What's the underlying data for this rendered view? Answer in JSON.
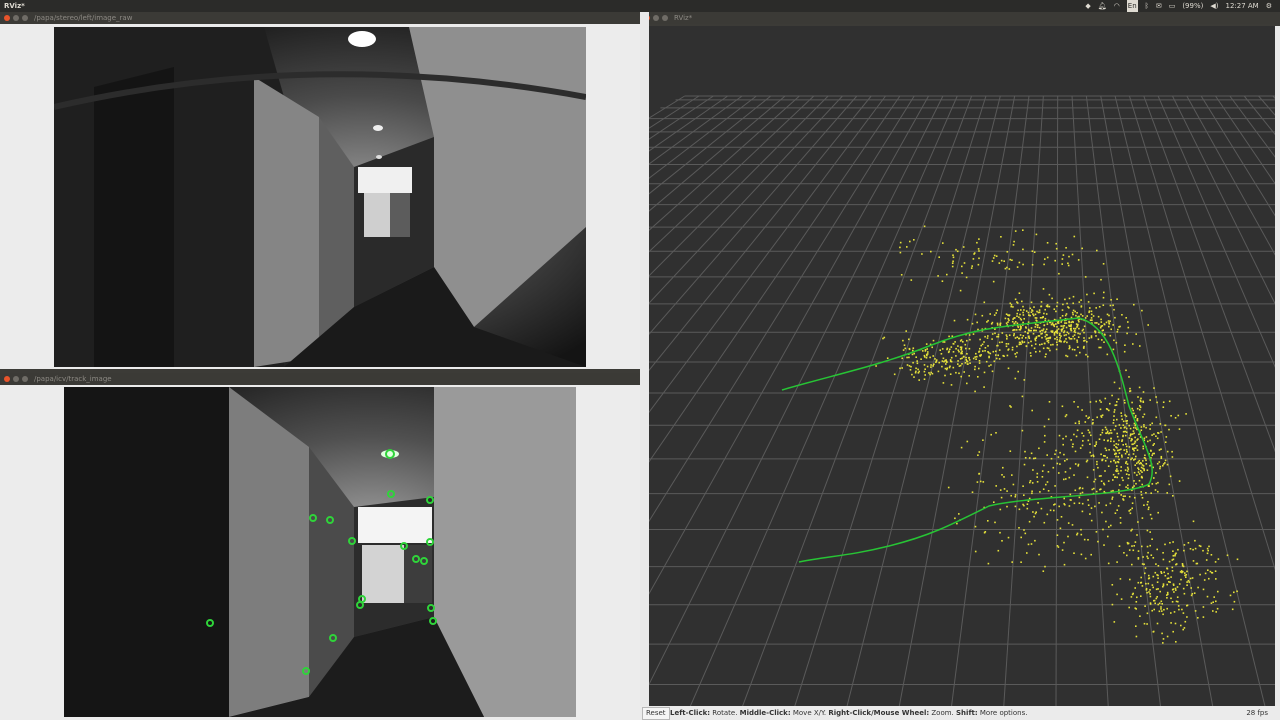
{
  "topbar": {
    "app_title": "RViz*",
    "tray": {
      "lang": "En",
      "battery": "(99%)",
      "clock": "12:27 AM"
    }
  },
  "left_window": {
    "title": "/papa/stereo/left/image_raw"
  },
  "track_window": {
    "title": "/papa/icv/track_image"
  },
  "rviz_window": {
    "title": "RViz*"
  },
  "statusbar": {
    "reset_label": "Reset",
    "help": [
      {
        "key": "Left-Click:",
        "action": " Rotate. "
      },
      {
        "key": "Middle-Click:",
        "action": " Move X/Y. "
      },
      {
        "key": "Right-Click/Mouse Wheel:",
        "action": " Zoom. "
      },
      {
        "key": "Shift:",
        "action": " More options."
      }
    ],
    "fps": "28 fps"
  },
  "colors": {
    "trajectory": "#27c435",
    "points": "#e6e23a",
    "feature": "#2fd43a",
    "close_button": "#e9542b"
  }
}
